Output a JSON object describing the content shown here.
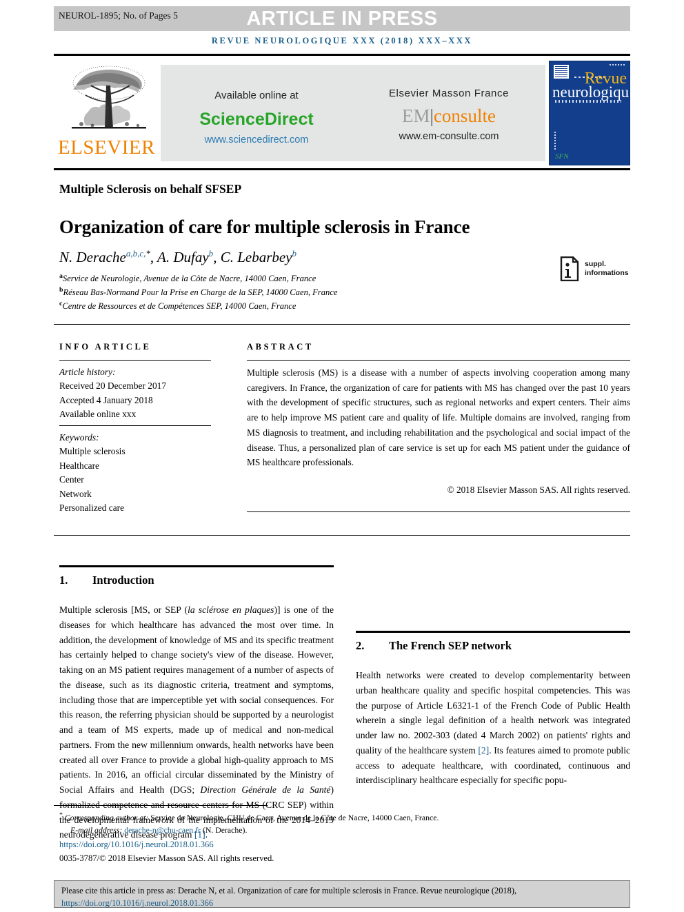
{
  "header": {
    "article_id": "NEUROL-1895; No. of Pages 5",
    "press_banner": "ARTICLE IN PRESS",
    "journal_running_head": "REVUE NEUROLOGIQUE XXX (2018) XXX–XXX"
  },
  "banner": {
    "elsevier_wordmark": "ELSEVIER",
    "available_online_at": "Available online at",
    "sciencedirect": "ScienceDirect",
    "sciencedirect_url": "www.sciencedirect.com",
    "elsevier_masson_france": "Elsevier Masson France",
    "em_prefix": "EM",
    "em_divider": "|",
    "em_suffix": "consulte",
    "emconsulte_url": "www.em-consulte.com",
    "cover_revue": "Revue",
    "cover_neurologique": "neurologique",
    "cover_society": "SFN"
  },
  "article": {
    "series": "Multiple Sclerosis on behalf SFSEP",
    "title": "Organization of care for multiple sclerosis in France",
    "authors": [
      {
        "name": "N. Derache",
        "marks": "a,b,c,",
        "star": "*",
        "sep": ", "
      },
      {
        "name": "A. Dufay",
        "marks": "b",
        "star": "",
        "sep": ", "
      },
      {
        "name": "C. Lebarbey",
        "marks": "b",
        "star": "",
        "sep": ""
      }
    ],
    "affiliations": [
      {
        "key": "a",
        "text": "Service de Neurologie, Avenue de la Côte de Nacre, 14000 Caen, France"
      },
      {
        "key": "b",
        "text": "Réseau Bas-Normand Pour la Prise en Charge de la SEP, 14000 Caen, France"
      },
      {
        "key": "c",
        "text": "Centre de Ressources et de Compétences SEP, 14000 Caen, France"
      }
    ],
    "suppl_line1": "suppl.",
    "suppl_line2": "informations"
  },
  "info_article": {
    "heading": "INFO ARTICLE",
    "history_label": "Article history:",
    "received": "Received 20 December 2017",
    "accepted": "Accepted 4 January 2018",
    "available_online": "Available online xxx",
    "keywords_label": "Keywords:",
    "keywords": [
      "Multiple sclerosis",
      "Healthcare",
      "Center",
      "Network",
      "Personalized care"
    ]
  },
  "abstract": {
    "heading": "ABSTRACT",
    "text": "Multiple sclerosis (MS) is a disease with a number of aspects involving cooperation among many caregivers. In France, the organization of care for patients with MS has changed over the past 10 years with the development of specific structures, such as regional networks and expert centers. Their aims are to help improve MS patient care and quality of life. Multiple domains are involved, ranging from MS diagnosis to treatment, and including rehabilitation and the psychological and social impact of the disease. Thus, a personalized plan of care service is set up for each MS patient under the guidance of MS healthcare professionals.",
    "copyright": "© 2018 Elsevier Masson SAS. All rights reserved."
  },
  "sections": {
    "intro": {
      "number": "1.",
      "title": "Introduction",
      "p1_a": "Multiple sclerosis [MS, or SEP (",
      "p1_italic": "la sclérose en plaques",
      "p1_b": ")] is one of the diseases for which healthcare has advanced the most over time. In addition, the development of knowledge of MS and its specific treatment has certainly helped to change society's view of the disease. However, taking on an MS patient requires management of a number of aspects of the disease, such as its diagnostic criteria, treatment and symptoms, including those that are imperceptible yet with social consequences. For this reason, the referring physician should be supported by a neurologist and a team of MS experts, made up of medical and non-medical partners. From the new millennium onwards, health networks have been created all over France to provide a global high-quality approach to MS patients. In 2016, an official circular disseminated by the Ministry of Social Affairs and Health (DGS; ",
      "p1_italic2": "Direction Générale de la Santé",
      "p1_c": ") formalized competence and resource centers for MS (CRC SEP) within the developmental framework of the implementation of the 2014–2019 neurodegenerative disease program ",
      "p1_ref": "[1]",
      "p1_d": "."
    },
    "network": {
      "number": "2.",
      "title": "The French SEP network",
      "p1_a": "Health networks were created to develop complementarity between urban healthcare quality and specific hospital competencies. This was the purpose of Article L6321-1 of the French Code of Public Health wherein a single legal definition of a health network was integrated under law no. 2002-303 (dated 4 March 2002) on patients' rights and quality of the healthcare system ",
      "p1_ref": "[2]",
      "p1_b": ". Its features aimed to promote public access to adequate healthcare, with coordinated, continuous and interdisciplinary healthcare especially for specific popu-"
    }
  },
  "footnotes": {
    "star": "*",
    "corresponding_label": "Corresponding author at:",
    "corresponding_text": " Service de Neurologie, CHU de Caen, Avenue de la Côte de Nacre, 14000 Caen, France.",
    "email_label": "E-mail address:",
    "email": "derache-n@chu-caen.fr",
    "email_suffix": " (N. Derache).",
    "doi": "https://doi.org/10.1016/j.neurol.2018.01.366",
    "issn_line": "0035-3787/© 2018 Elsevier Masson SAS. All rights reserved."
  },
  "cite_box": {
    "text_a": "Please cite this article in press as: Derache N, et al. Organization of care for multiple sclerosis in France. Revue neurologique (2018), ",
    "link": "https://doi.org/10.1016/j.neurol.2018.01.366"
  },
  "colors": {
    "accent_blue": "#1a5e8a",
    "elsevier_orange": "#f08000",
    "sciencedirect_green": "#28a428",
    "cover_blue": "#123e8c",
    "banner_gray": "#c6c6c6",
    "box_gray": "#e4e6e6",
    "cite_gray": "#d2d2d2"
  }
}
